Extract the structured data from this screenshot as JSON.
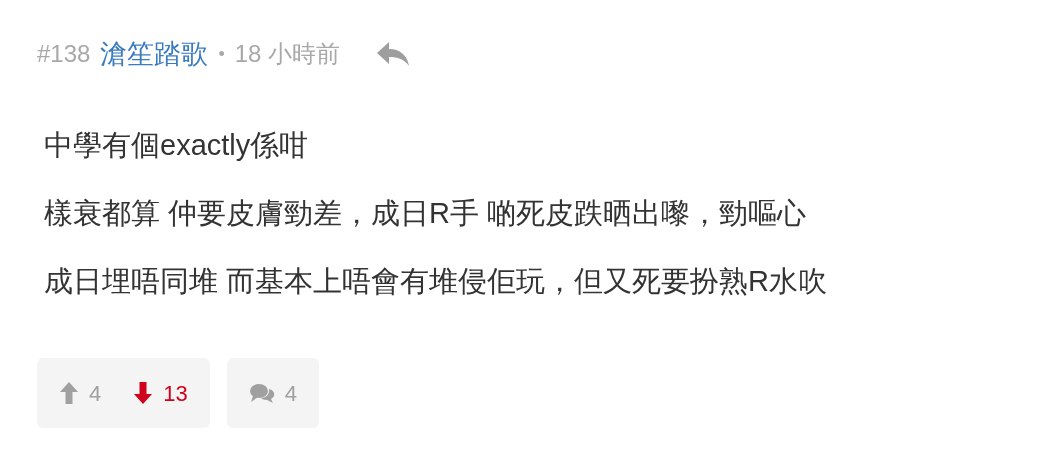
{
  "post": {
    "number": "#138",
    "author": "滄笙踏歌",
    "separator": "•",
    "time": "18 小時前"
  },
  "lines": [
    "中學有個exactly係咁",
    "樣衰都算 仲要皮膚勁差，成日R手 啲死皮跌晒出嚟，勁嘔心",
    "成日埋唔同堆 而基本上唔會有堆侵佢玩，但又死要扮熟R水吹"
  ],
  "votes": [
    {
      "kind": "up",
      "count": "4",
      "selected": false
    },
    {
      "kind": "down",
      "count": "13",
      "selected": true
    }
  ],
  "replies": {
    "count": "4"
  }
}
